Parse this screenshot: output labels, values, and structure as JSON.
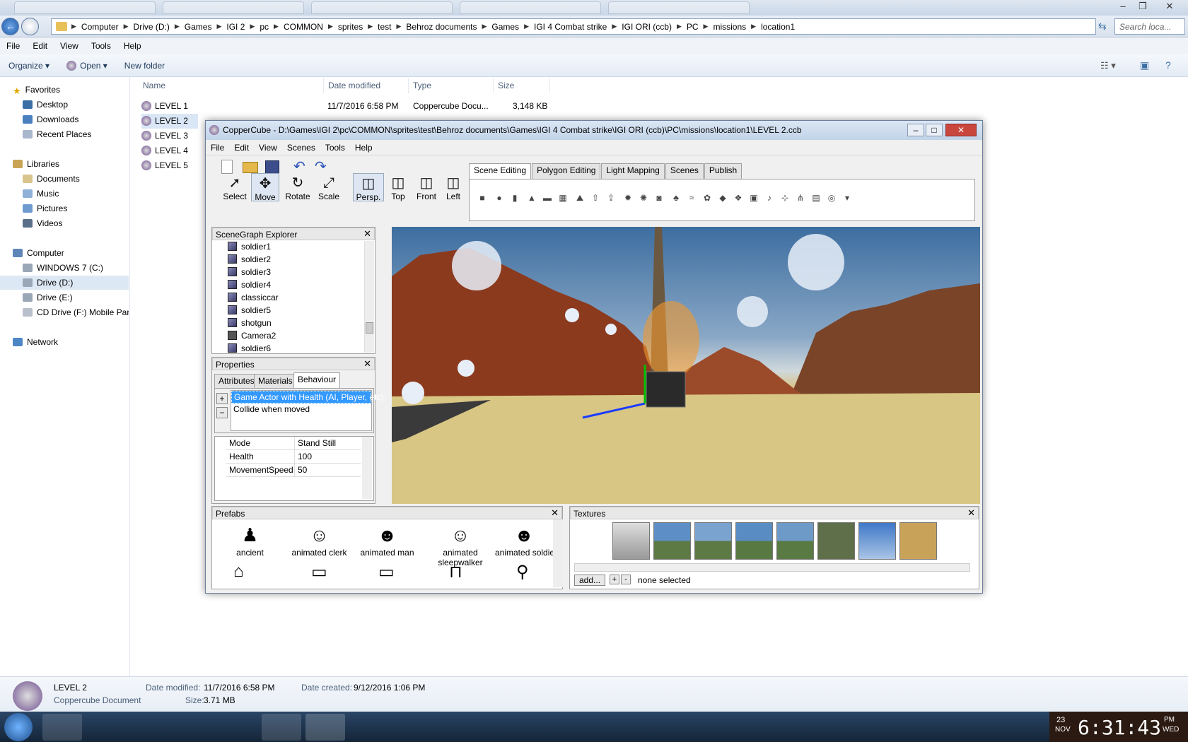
{
  "explorer": {
    "address": [
      "Computer",
      "Drive (D:)",
      "Games",
      "IGI 2",
      "pc",
      "COMMON",
      "sprites",
      "test",
      "Behroz documents",
      "Games",
      "IGI 4 Combat strike",
      "IGI ORI (ccb)",
      "PC",
      "missions",
      "location1"
    ],
    "search_placeholder": "Search loca...",
    "menu": [
      "File",
      "Edit",
      "View",
      "Tools",
      "Help"
    ],
    "toolbar": {
      "organize": "Organize",
      "open": "Open",
      "new_folder": "New folder"
    },
    "nav": {
      "favorites": "Favorites",
      "desktop": "Desktop",
      "downloads": "Downloads",
      "recent": "Recent Places",
      "libraries": "Libraries",
      "documents": "Documents",
      "music": "Music",
      "pictures": "Pictures",
      "videos": "Videos",
      "computer": "Computer",
      "c": "WINDOWS 7 (C:)",
      "d": "Drive (D:)",
      "e": "Drive (E:)",
      "f": "CD Drive (F:) Mobile Partr",
      "network": "Network"
    },
    "columns": {
      "name": "Name",
      "date": "Date modified",
      "type": "Type",
      "size": "Size"
    },
    "files": [
      {
        "name": "LEVEL 1",
        "date": "11/7/2016 6:58 PM",
        "type": "Coppercube Docu...",
        "size": "3,148 KB"
      },
      {
        "name": "LEVEL 2"
      },
      {
        "name": "LEVEL 3"
      },
      {
        "name": "LEVEL 4"
      },
      {
        "name": "LEVEL 5"
      }
    ],
    "details": {
      "name": "LEVEL 2",
      "kind": "Coppercube Document",
      "modified_label": "Date modified:",
      "modified": "11/7/2016 6:58 PM",
      "size_label": "Size:",
      "size": "3.71 MB",
      "created_label": "Date created:",
      "created": "9/12/2016 1:06 PM"
    }
  },
  "coppercube": {
    "title": "CopperCube - D:\\Games\\IGI 2\\pc\\COMMON\\sprites\\test\\Behroz documents\\Games\\IGI 4 Combat strike\\IGI ORI (ccb)\\PC\\missions\\location1\\LEVEL 2.ccb",
    "menu": [
      "File",
      "Edit",
      "View",
      "Scenes",
      "Tools",
      "Help"
    ],
    "tools": [
      "Select",
      "Move",
      "Rotate",
      "Scale",
      "Persp.",
      "Top",
      "Front",
      "Left"
    ],
    "tabs": [
      "Scene Editing",
      "Polygon Editing",
      "Light Mapping",
      "Scenes",
      "Publish"
    ],
    "scenegraph": {
      "title": "SceneGraph Explorer",
      "items": [
        "soldier1",
        "soldier2",
        "soldier3",
        "soldier4",
        "classiccar",
        "soldier5",
        "shotgun",
        "Camera2",
        "soldier6"
      ]
    },
    "properties": {
      "title": "Properties",
      "tabs": [
        "Attributes",
        "Materials",
        "Behaviour"
      ],
      "behaviours": [
        "Game Actor with Health (AI, Player, etc)",
        "Collide when moved"
      ],
      "rows": [
        {
          "k": "Mode",
          "v": "Stand Still"
        },
        {
          "k": "Health",
          "v": "100"
        },
        {
          "k": "MovementSpeed",
          "v": "50"
        }
      ]
    },
    "prefabs": {
      "title": "Prefabs",
      "items": [
        "ancient",
        "animated clerk",
        "animated man",
        "animated sleepwalker",
        "animated soldier"
      ]
    },
    "textures": {
      "title": "Textures",
      "add": "add...",
      "status": "none selected"
    }
  },
  "clock": {
    "day": "23",
    "month": "NOV",
    "time": "6:31:43",
    "ampm": "PM",
    "weekday": "WED"
  }
}
